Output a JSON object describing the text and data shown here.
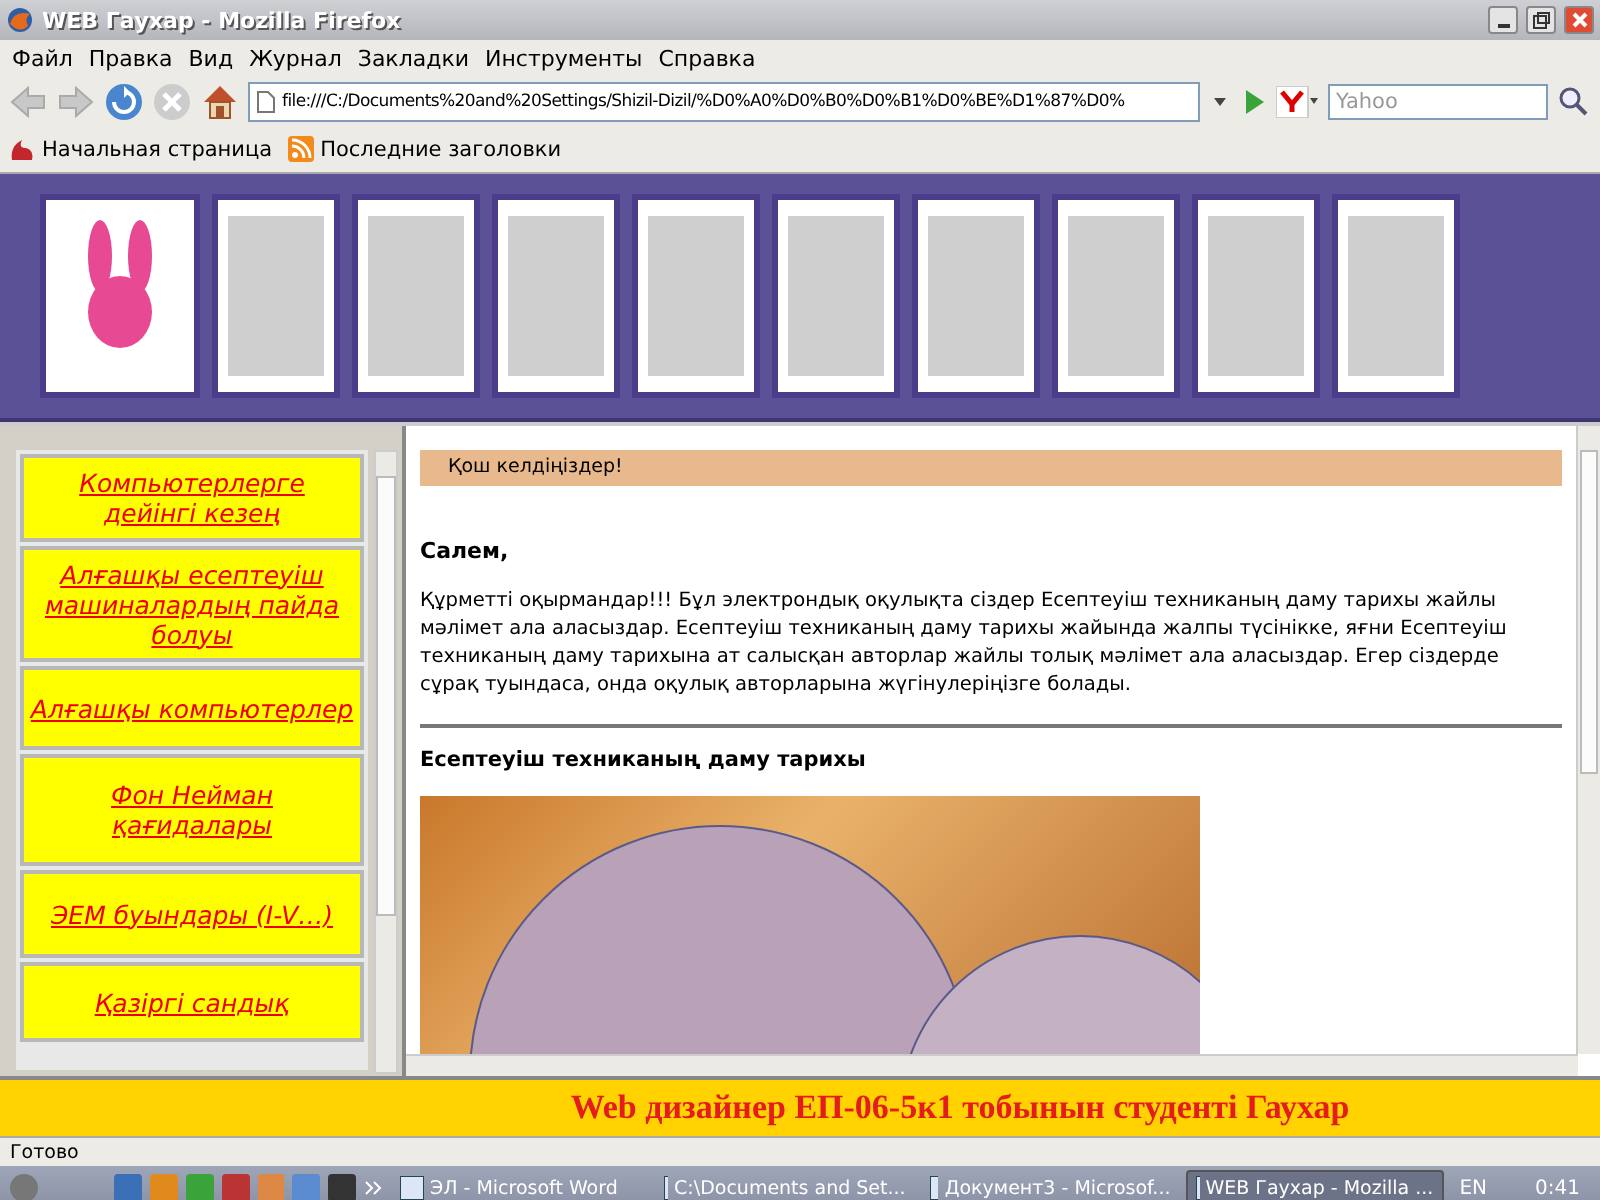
{
  "window": {
    "title": "WEB Гаухар - Mozilla Firefox"
  },
  "menu": [
    "Файл",
    "Правка",
    "Вид",
    "Журнал",
    "Закладки",
    "Инструменты",
    "Справка"
  ],
  "address": {
    "value": "file:///C:/Documents%20and%20Settings/Shizil-Dizil/%D0%A0%D0%B0%D0%B1%D0%BE%D1%87%D0%"
  },
  "search": {
    "placeholder": "Yahoo"
  },
  "bookmarks": [
    "Начальная страница",
    "Последние заголовки"
  ],
  "sidebar": {
    "items": [
      "Компьютерлерге дейінгі кезең",
      "Алғашқы есептеуіш машиналардың пайда болуы",
      "Алғашқы компьютерлер",
      "Фон Нейман қағидалары",
      "ЭЕМ буындары (I-V…)",
      "Қазіргі сандық"
    ]
  },
  "content": {
    "welcome": "Қош келдіңіздер!",
    "greeting": "Салем,",
    "paragraph": "Құрметті оқырмандар!!! Бұл электрондық оқулықта сіздер Есептеуіш техниканың даму тарихы жайлы мәлімет ала аласыздар. Есептеуіш техниканың даму тарихы жайында жалпы түсінікке, яғни Есептеуіш техниканың даму тарихына ат салысқан авторлар жайлы толық мәлімет ала аласыздар. Егер сіздерде сұрақ туындаса, онда оқулық авторларына жүгінулеріңізге болады.",
    "heading": "Есептеуіш техниканың даму тарихы"
  },
  "footer": "Web дизайнер ЕП-06-5к1 тобынын студенті Гаухар",
  "status_bar": "Готово",
  "taskbar": {
    "tasks": [
      {
        "label": "ЭЛ - Microsoft Word",
        "selected": false
      },
      {
        "label": "C:\\Documents and Set...",
        "selected": false
      },
      {
        "label": "Документ3 - Microsof...",
        "selected": false
      },
      {
        "label": "WEB Гаухар - Mozilla ...",
        "selected": true
      }
    ],
    "language": "EN",
    "clock": "0:41"
  }
}
